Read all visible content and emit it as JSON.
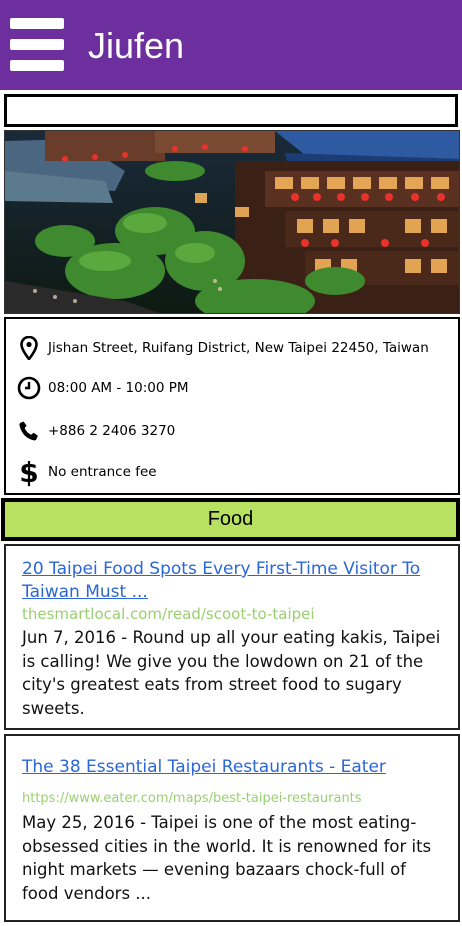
{
  "header": {
    "title": "Jiufen",
    "menu_icon": "hamburger-menu-icon",
    "background": "#6e2f9e"
  },
  "search": {
    "value": ""
  },
  "hero": {
    "image": "jiufen-teahouse-photo"
  },
  "info": {
    "address": "Jishan Street, Ruifang District, New Taipei 22450, Taiwan",
    "hours": "08:00 AM - 10:00 PM",
    "phone": "+886 2 2406 3270",
    "fee": "No entrance fee",
    "icons": [
      "location-pin-icon",
      "clock-icon",
      "phone-icon",
      "dollar-icon"
    ]
  },
  "section": {
    "label": "Food",
    "color": "#b8e061"
  },
  "results": [
    {
      "title": "20 Taipei Food Spots Every First-Time Visitor To Taiwan Must ...",
      "url": "thesmartlocal.com/read/scoot-to-taipei",
      "snippet": "Jun 7, 2016 - Round up all your eating kakis, Taipei is calling! We give you the lowdown on 21 of the city's greatest eats from street food to sugary sweets."
    },
    {
      "title": "The 38 Essential Taipei Restaurants - Eater",
      "url": "https://www.eater.com/maps/best-taipei-restaurants",
      "snippet": "May 25, 2016 - Taipei is one of the most eating-obsessed cities in the world. It is renowned for its night markets — evening bazaars chock-full of food vendors ..."
    }
  ]
}
